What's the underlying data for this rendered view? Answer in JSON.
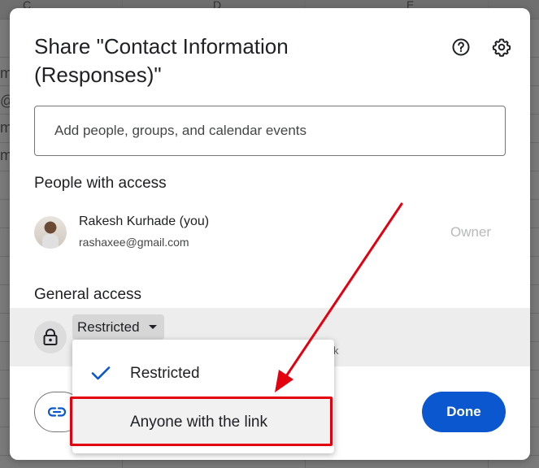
{
  "background_sheet": {
    "col_letters": [
      "C",
      "D",
      "E"
    ],
    "row_fragments": [
      "ma",
      "@g",
      "m",
      "m"
    ]
  },
  "dialog": {
    "title": "Share \"Contact Information (Responses)\"",
    "search_placeholder": "Add people, groups, and calendar events",
    "people_label": "People with access",
    "person": {
      "name": "Rakesh Kurhade (you)",
      "email": "rashaxee@gmail.com",
      "role": "Owner"
    },
    "general_access_label": "General access",
    "access_value": "Restricted",
    "hidden_desc_fragment": "k",
    "done_label": "Done"
  },
  "menu": {
    "items": [
      {
        "label": "Restricted",
        "selected": true
      },
      {
        "label": "Anyone with the link",
        "selected": false
      }
    ]
  },
  "icons": {
    "help": "help-circle-icon",
    "settings": "gear-icon",
    "lock": "lock-icon",
    "dropdown": "caret-down-icon",
    "check": "checkmark-icon",
    "link": "link-icon"
  },
  "colors": {
    "primary": "#0b57d0",
    "annotation": "#e3000f"
  }
}
